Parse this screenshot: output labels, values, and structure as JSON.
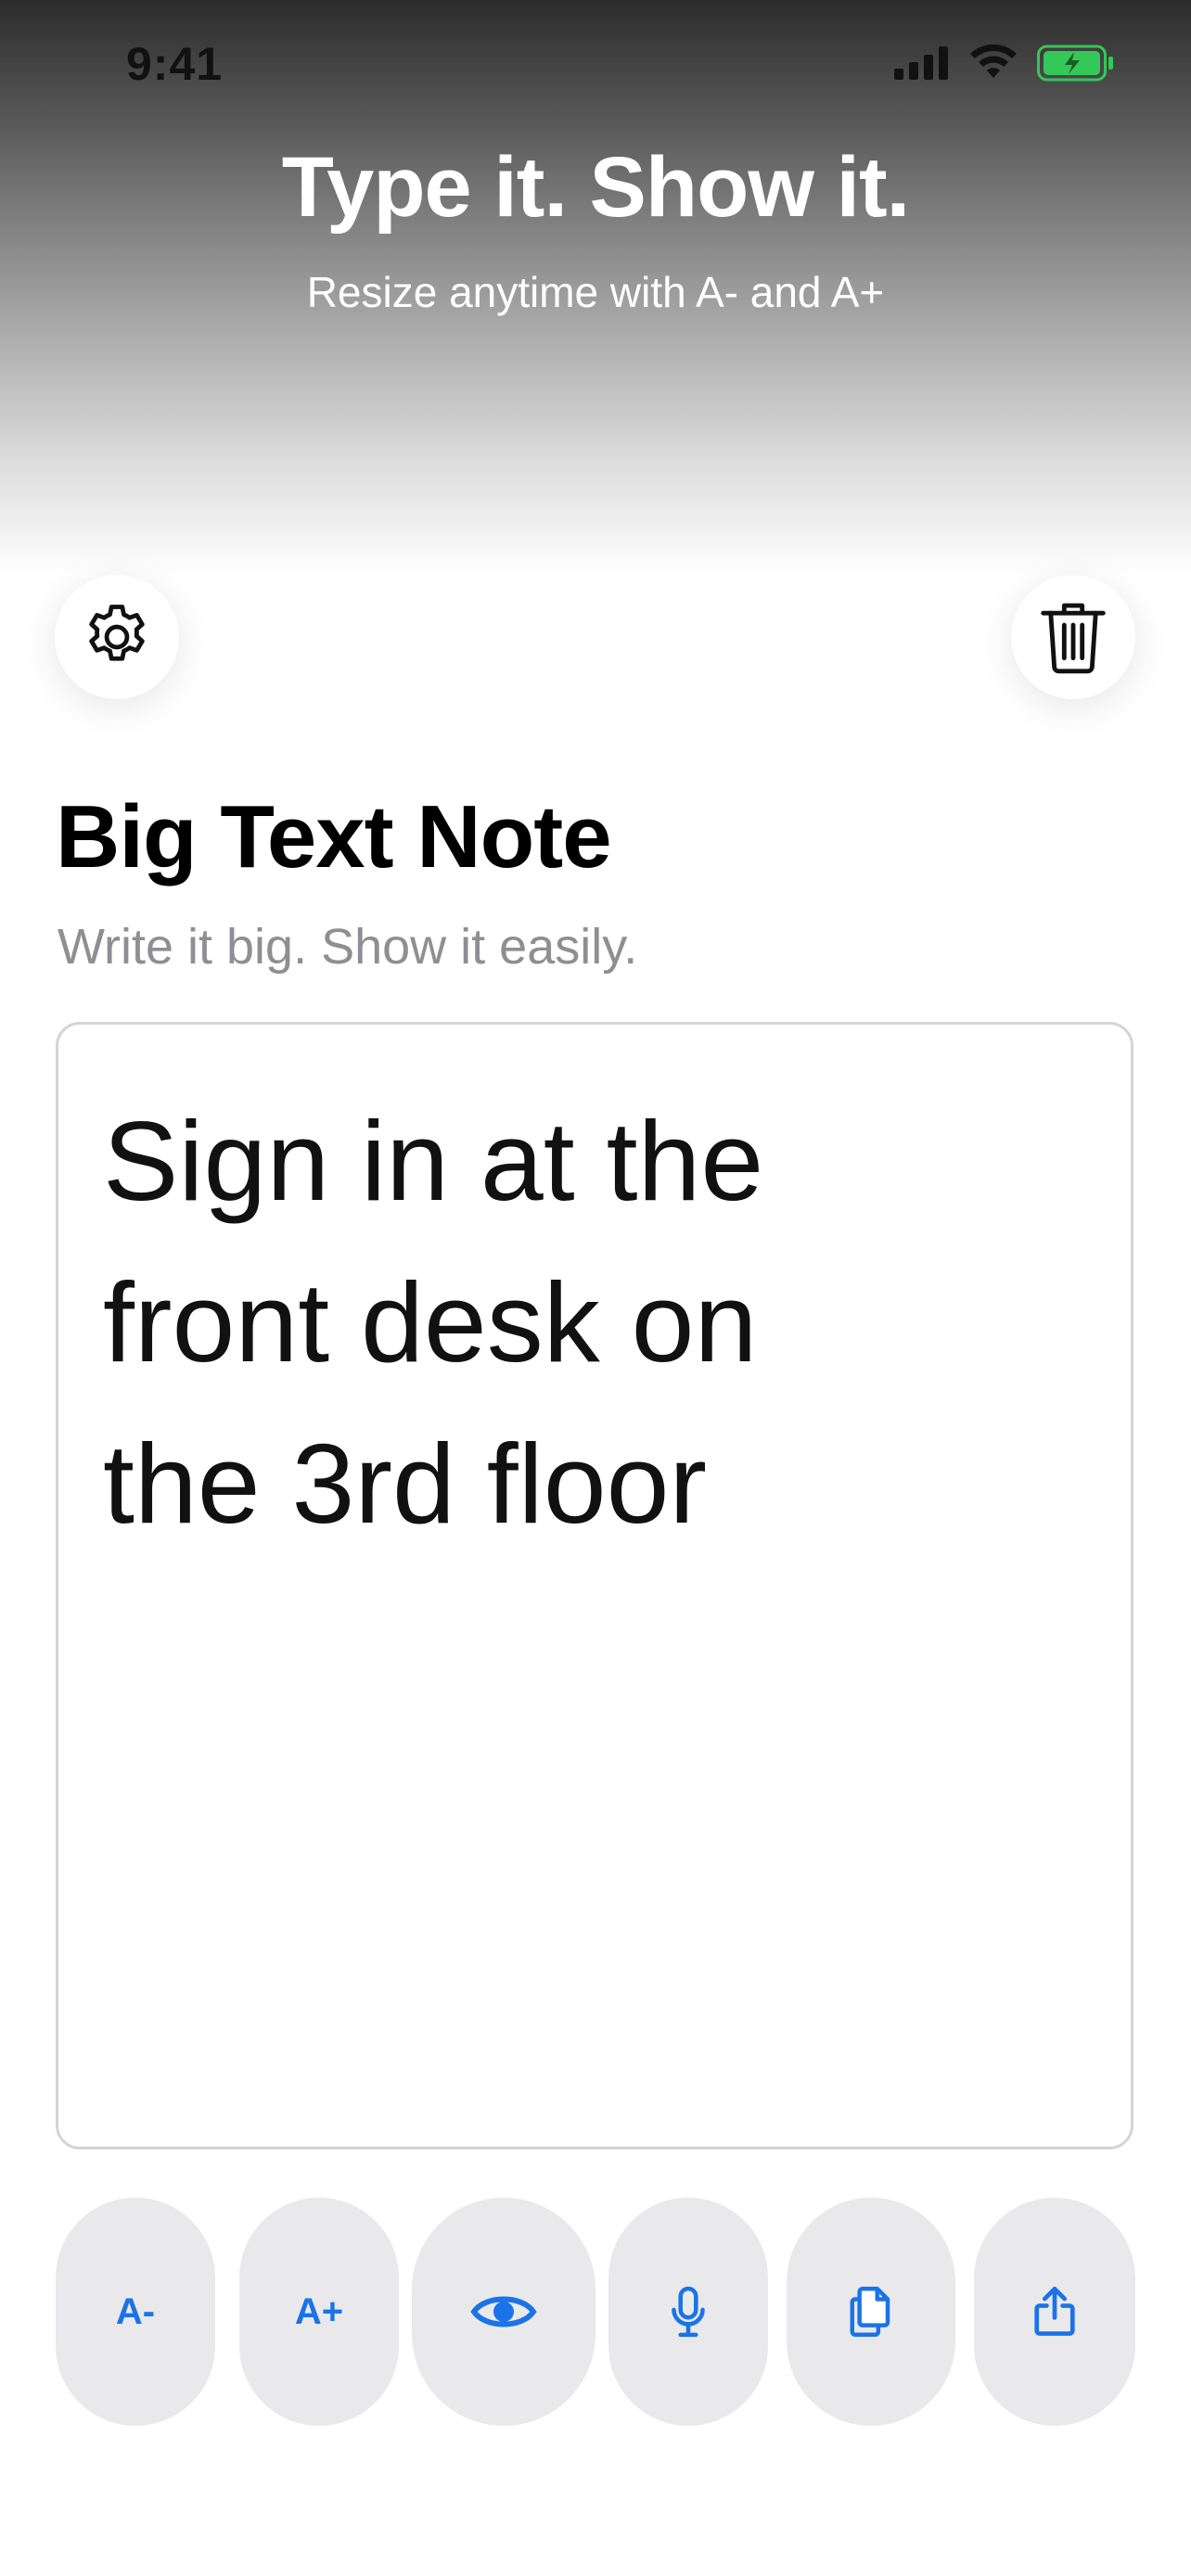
{
  "status_bar": {
    "time": "9:41"
  },
  "hero": {
    "title": "Type it. Show it.",
    "subtitle": "Resize anytime with A- and A+"
  },
  "header": {
    "title": "Big Text Note",
    "subtitle": "Write it big. Show it easily."
  },
  "editor": {
    "text": "Sign in at the front desk on the 3rd floor"
  },
  "toolbar": {
    "decrease_label": "A-",
    "increase_label": "A+"
  },
  "icons": {
    "settings": "gear-icon",
    "trash": "trash-icon",
    "eye": "eye-icon",
    "mic": "microphone-icon",
    "copy": "copy-icon",
    "share": "share-icon"
  },
  "colors": {
    "accent": "#1a73e8",
    "tool_bg": "#e9e9ec",
    "subtitle_gray": "#8e8e93",
    "battery_green": "#34c759"
  }
}
